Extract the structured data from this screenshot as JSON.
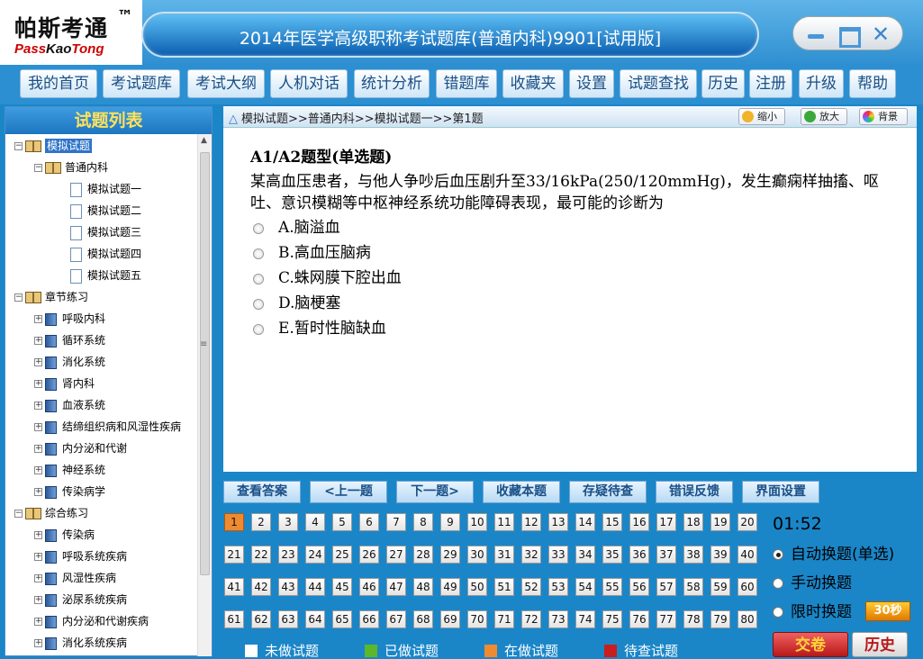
{
  "app": {
    "logo_cn": "帕斯考通",
    "logo_tm": "™",
    "logo_en_red": "Pass",
    "logo_en_black": "Kao",
    "logo_en_red2": "Tong",
    "title": "2014年医学高级职称考试题库(普通内科)9901[试用版]"
  },
  "menu": [
    "我的首页",
    "考试题库",
    "考试大纲",
    "人机对话",
    "统计分析",
    "错题库",
    "收藏夹",
    "设置",
    "试题查找",
    "历史",
    "注册",
    "升级",
    "帮助"
  ],
  "sidebar": {
    "title": "试题列表",
    "tree": [
      {
        "label": "模拟试题",
        "selected": true
      },
      {
        "label": "普通内科"
      },
      {
        "label": "模拟试题一"
      },
      {
        "label": "模拟试题二"
      },
      {
        "label": "模拟试题三"
      },
      {
        "label": "模拟试题四"
      },
      {
        "label": "模拟试题五"
      },
      {
        "label": "章节练习"
      },
      {
        "label": "呼吸内科"
      },
      {
        "label": "循环系统"
      },
      {
        "label": "消化系统"
      },
      {
        "label": "肾内科"
      },
      {
        "label": "血液系统"
      },
      {
        "label": "结缔组织病和风湿性疾病"
      },
      {
        "label": "内分泌和代谢"
      },
      {
        "label": "神经系统"
      },
      {
        "label": "传染病学"
      },
      {
        "label": "综合练习"
      },
      {
        "label": "传染病"
      },
      {
        "label": "呼吸系统疾病"
      },
      {
        "label": "风湿性疾病"
      },
      {
        "label": "泌尿系统疾病"
      },
      {
        "label": "内分泌和代谢疾病"
      },
      {
        "label": "消化系统疾病"
      }
    ]
  },
  "breadcrumb": "模拟试题>>普通内科>>模拟试题一>>第1题",
  "toolbar": {
    "shrink": "缩小",
    "enlarge": "放大",
    "background": "背景"
  },
  "question": {
    "type": "A1/A2题型(单选题)",
    "text": "某高血压患者，与他人争吵后血压剧升至33/16kPa(250/120mmHg)，发生癫痫样抽搐、呕吐、意识模糊等中枢神经系统功能障碍表现，最可能的诊断为",
    "options": [
      "A.脑溢血",
      "B.高血压脑病",
      "C.蛛网膜下腔出血",
      "D.脑梗塞",
      "E.暂时性脑缺血"
    ]
  },
  "actions": [
    "查看答案",
    "<上一题",
    "下一题>",
    "收藏本题",
    "存疑待查",
    "错误反馈",
    "界面设置"
  ],
  "numbers": {
    "current": 1,
    "total": 80
  },
  "timer": "01:52",
  "modes": [
    {
      "label": "自动换题(单选)",
      "checked": true
    },
    {
      "label": "手动换题",
      "checked": false
    },
    {
      "label": "限时换题",
      "checked": false
    }
  ],
  "time_limit_badge": "30秒",
  "legend": [
    {
      "label": "未做试题",
      "color": "#ffffff"
    },
    {
      "label": "已做试题",
      "color": "#5cb82a"
    },
    {
      "label": "在做试题",
      "color": "#f08a30"
    },
    {
      "label": "待查试题",
      "color": "#c81e1e"
    }
  ],
  "submit": "交卷",
  "history": "历史"
}
